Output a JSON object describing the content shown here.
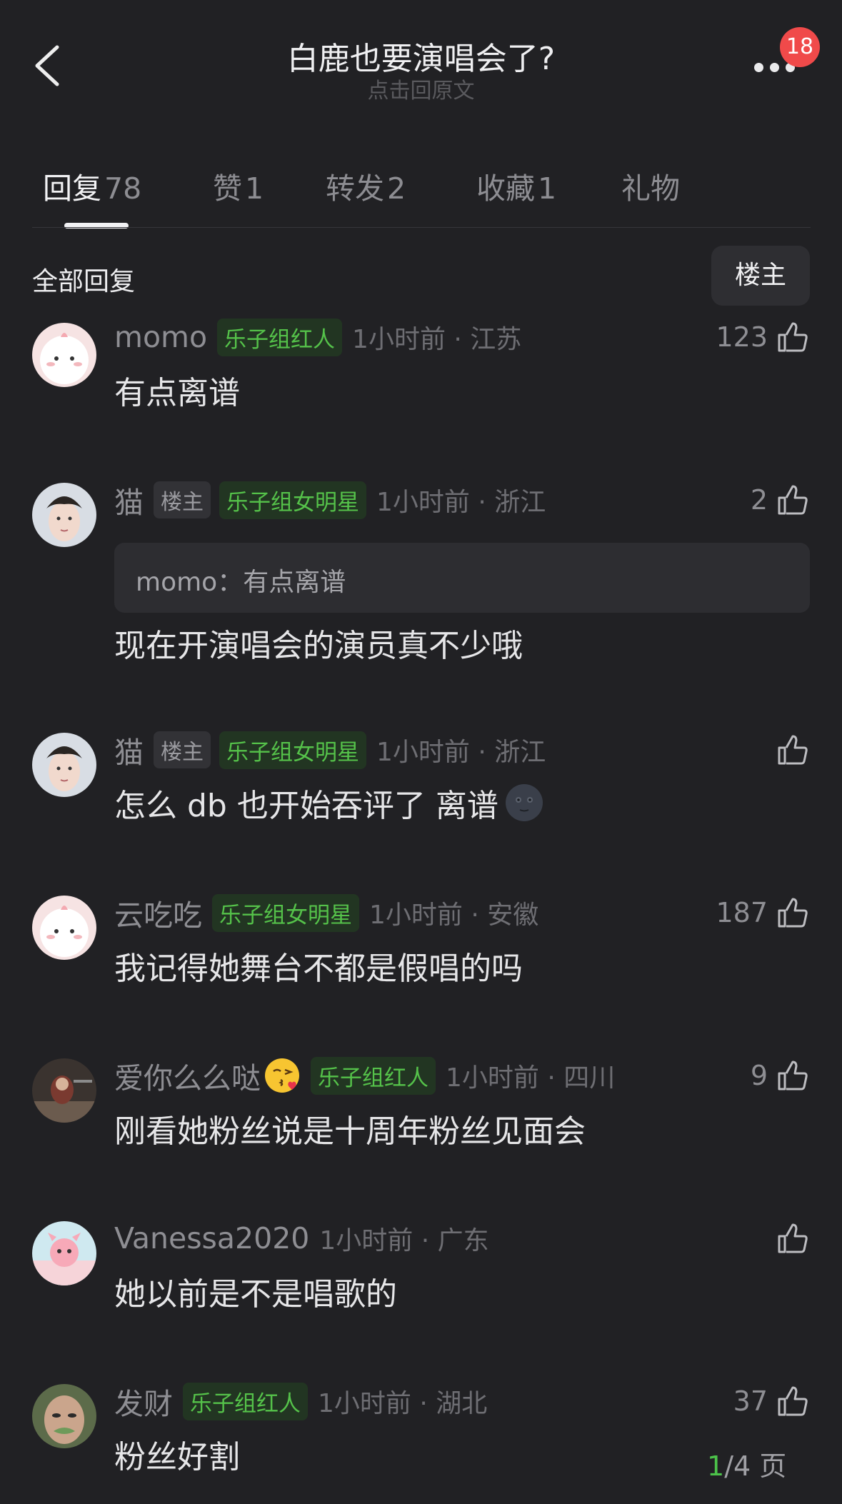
{
  "header": {
    "title": "白鹿也要演唱会了?",
    "subtitle": "点击回原文",
    "notification_count": "18"
  },
  "tabs": [
    {
      "label": "回复",
      "count": "78",
      "active": true
    },
    {
      "label": "赞",
      "count": "1"
    },
    {
      "label": "转发",
      "count": "2"
    },
    {
      "label": "收藏",
      "count": "1"
    },
    {
      "label": "礼物",
      "count": ""
    }
  ],
  "section": {
    "title": "全部回复",
    "filter_label": "楼主"
  },
  "comments": [
    {
      "username": "momo",
      "badge": "乐子组红人",
      "time": "1小时前",
      "location": "江苏",
      "time_loc": "1小时前 · 江苏",
      "likes": "123",
      "text": "有点离谱"
    },
    {
      "username": "猫",
      "op_tag": "楼主",
      "badge": "乐子组女明星",
      "time_loc": "1小时前 · 浙江",
      "likes": "2",
      "quote": "momo：有点离谱",
      "text": "现在开演唱会的演员真不少哦"
    },
    {
      "username": "猫",
      "op_tag": "楼主",
      "badge": "乐子组女明星",
      "time_loc": "1小时前 · 浙江",
      "likes": "",
      "text": "怎么 db 也开始吞评了 离谱"
    },
    {
      "username": "云吃吃",
      "badge": "乐子组女明星",
      "time_loc": "1小时前 · 安徽",
      "likes": "187",
      "text": "我记得她舞台不都是假唱的吗"
    },
    {
      "username": "爱你么么哒",
      "badge": "乐子组红人",
      "time_loc": "1小时前 · 四川",
      "likes": "9",
      "text": "刚看她粉丝说是十周年粉丝见面会"
    },
    {
      "username": "Vanessa2020",
      "time_loc": "1小时前 · 广东",
      "likes": "",
      "text": "她以前是不是唱歌的"
    },
    {
      "username": "发财",
      "badge": "乐子组红人",
      "time_loc": "1小时前 · 湖北",
      "likes": "37",
      "text": "粉丝好割"
    }
  ],
  "pager": {
    "current": "1",
    "rest": "/4 页"
  },
  "colors": {
    "background": "#212124",
    "badge_green": "#55c24a",
    "notification_red": "#f04a4a"
  }
}
